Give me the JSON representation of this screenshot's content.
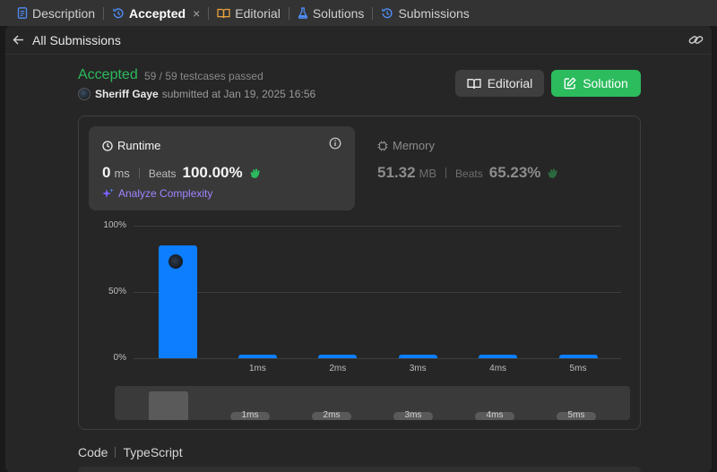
{
  "tabs": [
    {
      "label": "Description",
      "icon": "description-icon"
    },
    {
      "label": "Accepted",
      "icon": "history-icon",
      "active": true,
      "closable": true
    },
    {
      "label": "Editorial",
      "icon": "book-icon"
    },
    {
      "label": "Solutions",
      "icon": "flask-icon"
    },
    {
      "label": "Submissions",
      "icon": "history-icon"
    }
  ],
  "tab_close_glyph": "×",
  "back": {
    "label": "All Submissions"
  },
  "submission": {
    "status": "Accepted",
    "passed": "59 / 59 testcases passed",
    "user": "Sheriff Gaye",
    "submitted_text": "submitted at Jan 19, 2025 16:56"
  },
  "buttons": {
    "editorial": "Editorial",
    "solution": "Solution"
  },
  "runtime": {
    "title": "Runtime",
    "value": "0",
    "unit": "ms",
    "beats_label": "Beats",
    "beats": "100.00%",
    "analyze": "Analyze Complexity"
  },
  "memory": {
    "title": "Memory",
    "value": "51.32",
    "unit": "MB",
    "beats_label": "Beats",
    "beats": "65.23%"
  },
  "chart_data": {
    "type": "bar",
    "categories": [
      "0ms",
      "1ms",
      "2ms",
      "3ms",
      "4ms",
      "5ms"
    ],
    "x_tick_labels": [
      "",
      "1ms",
      "2ms",
      "3ms",
      "4ms",
      "5ms"
    ],
    "values": [
      85,
      3,
      3,
      3,
      3,
      3
    ],
    "ylim": [
      0,
      100
    ],
    "y_ticks": [
      "0%",
      "50%",
      "100%"
    ],
    "y_tick_values": [
      0,
      50,
      100
    ],
    "bar_color": "#0d7eff",
    "grid": true,
    "highlight_category": "0ms",
    "mini_tick_labels": [
      "1ms",
      "2ms",
      "3ms",
      "4ms",
      "5ms"
    ]
  },
  "code_section": {
    "label": "Code",
    "language": "TypeScript"
  },
  "colors": {
    "accepted": "#2cbb5d",
    "solution_button": "#2cbb5d",
    "analyze": "#a084ff",
    "bar": "#0d7eff"
  }
}
